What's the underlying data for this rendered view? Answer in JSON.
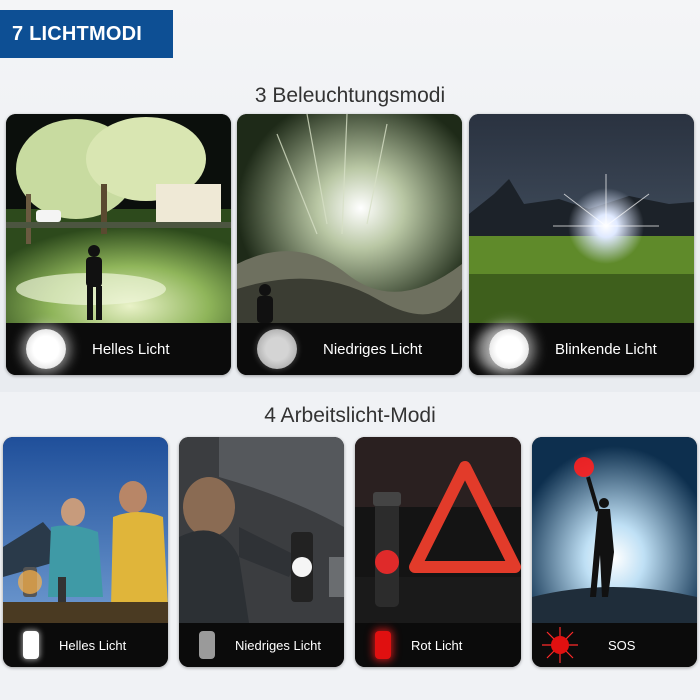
{
  "banner": {
    "title": "7 LICHTMODI"
  },
  "section_lighting": {
    "title": "3 Beleuchtungsmodi",
    "modes": [
      {
        "label": "Helles Licht",
        "icon": "bright-lamp-icon"
      },
      {
        "label": "Niedriges Licht",
        "icon": "dim-lamp-icon"
      },
      {
        "label": "Blinkende Licht",
        "icon": "blinking-lamp-icon"
      }
    ]
  },
  "section_work": {
    "title": "4 Arbeitslicht-Modi",
    "modes": [
      {
        "label": "Helles Licht",
        "icon": "bright-bar-icon"
      },
      {
        "label": "Niedriges Licht",
        "icon": "dim-bar-icon"
      },
      {
        "label": "Rot Licht",
        "icon": "red-bar-icon"
      },
      {
        "label": "SOS",
        "icon": "sos-flash-icon"
      }
    ]
  },
  "colors": {
    "banner": "#0d4f94",
    "card_bar": "#0b0b0b",
    "red_light": "#e01010"
  }
}
